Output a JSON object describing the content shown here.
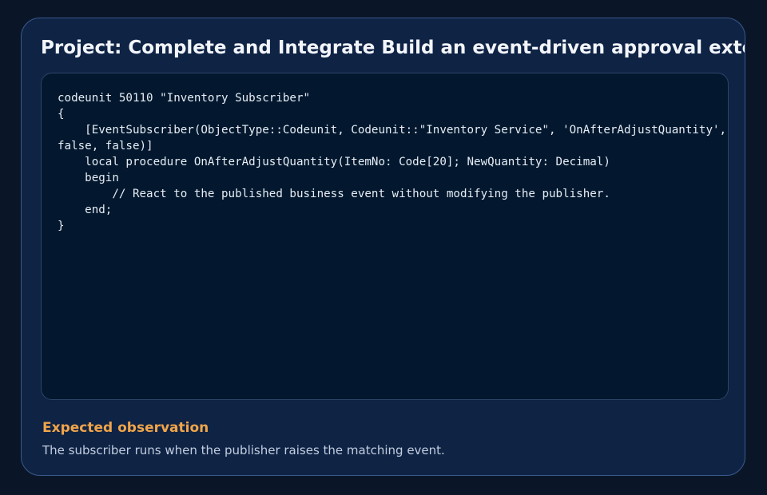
{
  "card": {
    "title": "Project: Complete and Integrate Build an event-driven approval extension"
  },
  "code": {
    "text": "codeunit 50110 \"Inventory Subscriber\"\n{\n    [EventSubscriber(ObjectType::Codeunit, Codeunit::\"Inventory Service\", 'OnAfterAdjustQuantity', '', false, false)]\n    local procedure OnAfterAdjustQuantity(ItemNo: Code[20]; NewQuantity: Decimal)\n    begin\n        // React to the published business event without modifying the publisher.\n    end;\n}"
  },
  "observation": {
    "heading": "Expected observation",
    "text": "The subscriber runs when the publisher raises the matching event."
  }
}
